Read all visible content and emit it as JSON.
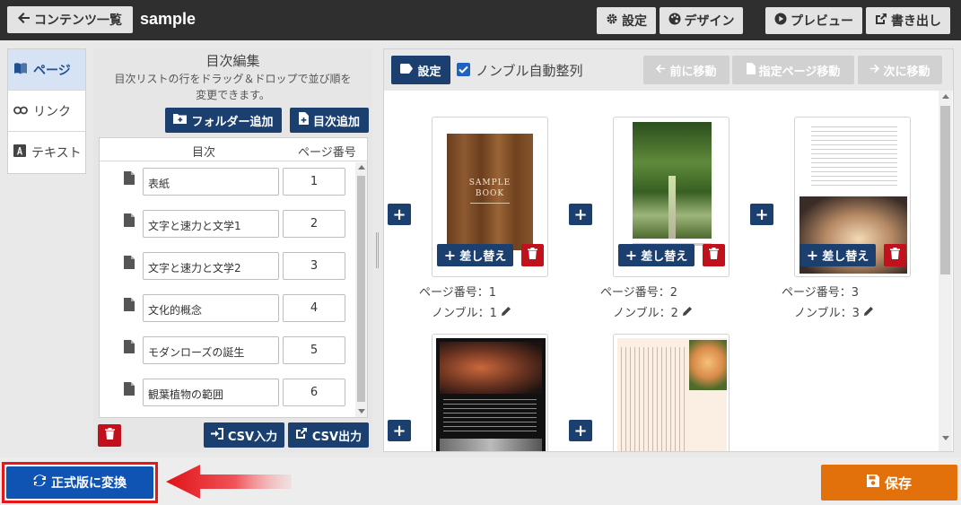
{
  "topbar": {
    "back_label": "コンテンツ一覧",
    "title": "sample",
    "settings_label": "設定",
    "design_label": "デザイン",
    "preview_label": "プレビュー",
    "export_label": "書き出し"
  },
  "tabs": [
    {
      "label": "ページ",
      "active": true
    },
    {
      "label": "リンク",
      "active": false
    },
    {
      "label": "テキスト",
      "active": false
    }
  ],
  "toc": {
    "title": "目次編集",
    "description_line1": "目次リストの行をドラッグ＆ドロップで並び順を",
    "description_line2": "変更できます。",
    "add_folder_label": "フォルダー追加",
    "add_toc_label": "目次追加",
    "col_toc": "目次",
    "col_page": "ページ番号",
    "rows": [
      {
        "name": "表紙",
        "page": "1"
      },
      {
        "name": "文字と速力と文学1",
        "page": "2"
      },
      {
        "name": "文字と速力と文学2",
        "page": "3"
      },
      {
        "name": "文化的概念",
        "page": "4"
      },
      {
        "name": "モダンローズの誕生",
        "page": "5"
      },
      {
        "name": "観葉植物の範囲",
        "page": "6"
      }
    ],
    "csv_in_label": "CSV入力",
    "csv_out_label": "CSV出力"
  },
  "preview": {
    "settings_label": "設定",
    "nonble_label": "ノンブル自動整列",
    "nonble_checked": true,
    "prev_label": "前に移動",
    "goto_label": "指定ページ移動",
    "next_label": "次に移動",
    "replace_label": "差し替え",
    "cover_title1": "SAMPLE",
    "cover_title2": "BOOK",
    "pages": [
      {
        "page_label": "ページ番号：1",
        "nonble_label": "ノンブル：1"
      },
      {
        "page_label": "ページ番号：2",
        "nonble_label": "ノンブル：2"
      },
      {
        "page_label": "ページ番号：3",
        "nonble_label": "ノンブル：3"
      }
    ]
  },
  "bottom": {
    "convert_label": "正式版に変換",
    "save_label": "保存"
  },
  "colors": {
    "navy": "#1b3f6e",
    "red": "#c0111c",
    "convert_blue": "#0f54b3",
    "save_orange": "#e2710b",
    "highlight_red": "#e8161a"
  }
}
